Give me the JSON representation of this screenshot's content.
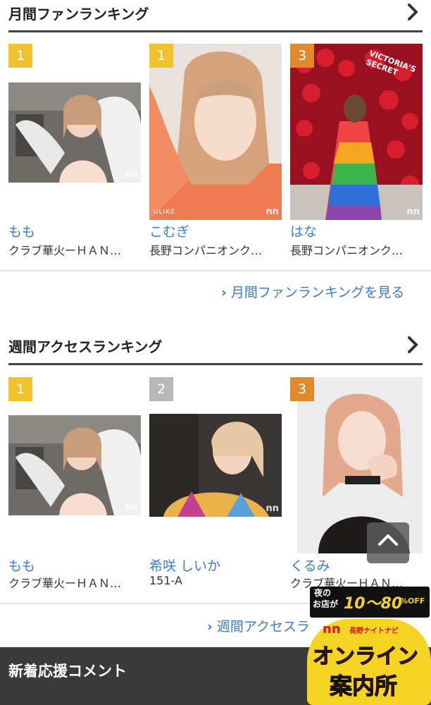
{
  "monthly": {
    "title": "月間ファンランキング",
    "more_link": "月間ファンランキングを見る",
    "cards": [
      {
        "rank": "1",
        "name": "もも",
        "shop": "クラブ華火ーＨＡＮ…"
      },
      {
        "rank": "1",
        "name": "こむぎ",
        "shop": "長野コンパニオンク…",
        "photo_caption": "ULIKE"
      },
      {
        "rank": "3",
        "name": "はな",
        "shop": "長野コンパニオンク…",
        "photo_caption": "VICTORIA'S SECRET"
      }
    ]
  },
  "weekly": {
    "title": "週間アクセスランキング",
    "more_link": "週間アクセスラ",
    "cards": [
      {
        "rank": "1",
        "name": "もも",
        "shop": "クラブ華火ーＨＡＮ…"
      },
      {
        "rank": "2",
        "name": "希咲 しいか",
        "shop": "151-A"
      },
      {
        "rank": "3",
        "name": "くるみ",
        "shop": "クラブ華火ーＨＡＮ…"
      }
    ]
  },
  "new_comments": {
    "title": "新着応援コメント"
  },
  "watermark": "nn",
  "banner": {
    "line1a": "夜の",
    "line1b": "お店が",
    "discount": "10〜80",
    "percent": "%OFF",
    "subtitle": "長野ナイトナビ",
    "line2": "オンライン",
    "line3": "案内所"
  },
  "icons": {
    "section_arrow": "chevron-right-icon",
    "link_arrow": "chevron-right-icon",
    "scroll_top": "chevron-up-icon"
  },
  "colors": {
    "accent": "#3a7bd5",
    "gold": "#f2c12e",
    "silver": "#b8b8b8",
    "bronze": "#e08a2c",
    "banner_red": "#d8141c"
  }
}
